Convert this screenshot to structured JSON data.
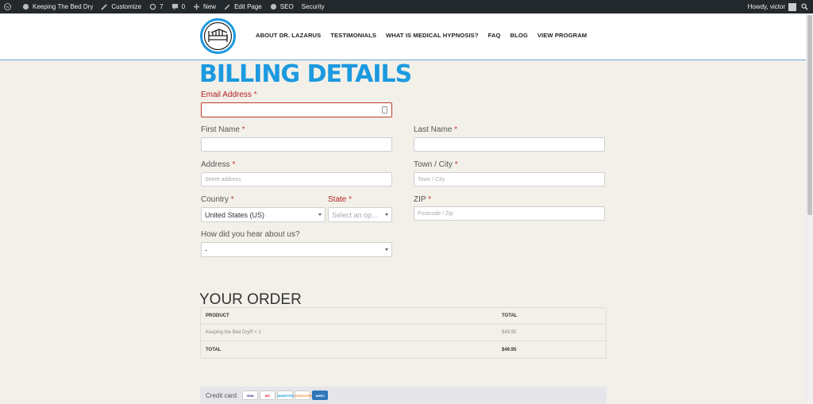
{
  "admin_bar": {
    "site_name": "Keeping The Bed Dry",
    "customize": "Customize",
    "updates_count": "7",
    "comments_count": "0",
    "new": "New",
    "edit_page": "Edit Page",
    "seo": "SEO",
    "security": "Security",
    "howdy": "Howdy, victor"
  },
  "nav": {
    "items": [
      "ABOUT DR. LAZARUS",
      "TESTIMONIALS",
      "WHAT IS MEDICAL HYPNOSIS?",
      "FAQ",
      "BLOG",
      "VIEW PROGRAM"
    ]
  },
  "page_title": "BILLING DETAILS",
  "form": {
    "email_label": "Email Address",
    "first_name_label": "First Name",
    "last_name_label": "Last Name",
    "address_label": "Address",
    "address_placeholder": "Street address",
    "city_label": "Town / City",
    "city_placeholder": "Town / City",
    "country_label": "Country",
    "country_value": "United States (US)",
    "state_label": "State",
    "state_placeholder": "Select an op...",
    "zip_label": "ZIP",
    "zip_placeholder": "Postcode / Zip",
    "hear_label": "How did you hear about us?",
    "hear_value": "-",
    "required_mark": "*"
  },
  "order": {
    "title": "YOUR ORDER",
    "col_product": "PRODUCT",
    "col_total": "TOTAL",
    "item_name": "Keeping the Bed Dry® × 1",
    "item_price": "$49.95",
    "total_label": "TOTAL",
    "total_value": "$49.95"
  },
  "payment": {
    "label": "Credit card",
    "cards": [
      "VISA",
      "MC",
      "MAESTRO",
      "DISCOVER",
      "AMEX"
    ]
  },
  "colors": {
    "accent": "#1c9ae0",
    "required": "#c0392b",
    "admin_bar": "#23282d"
  }
}
